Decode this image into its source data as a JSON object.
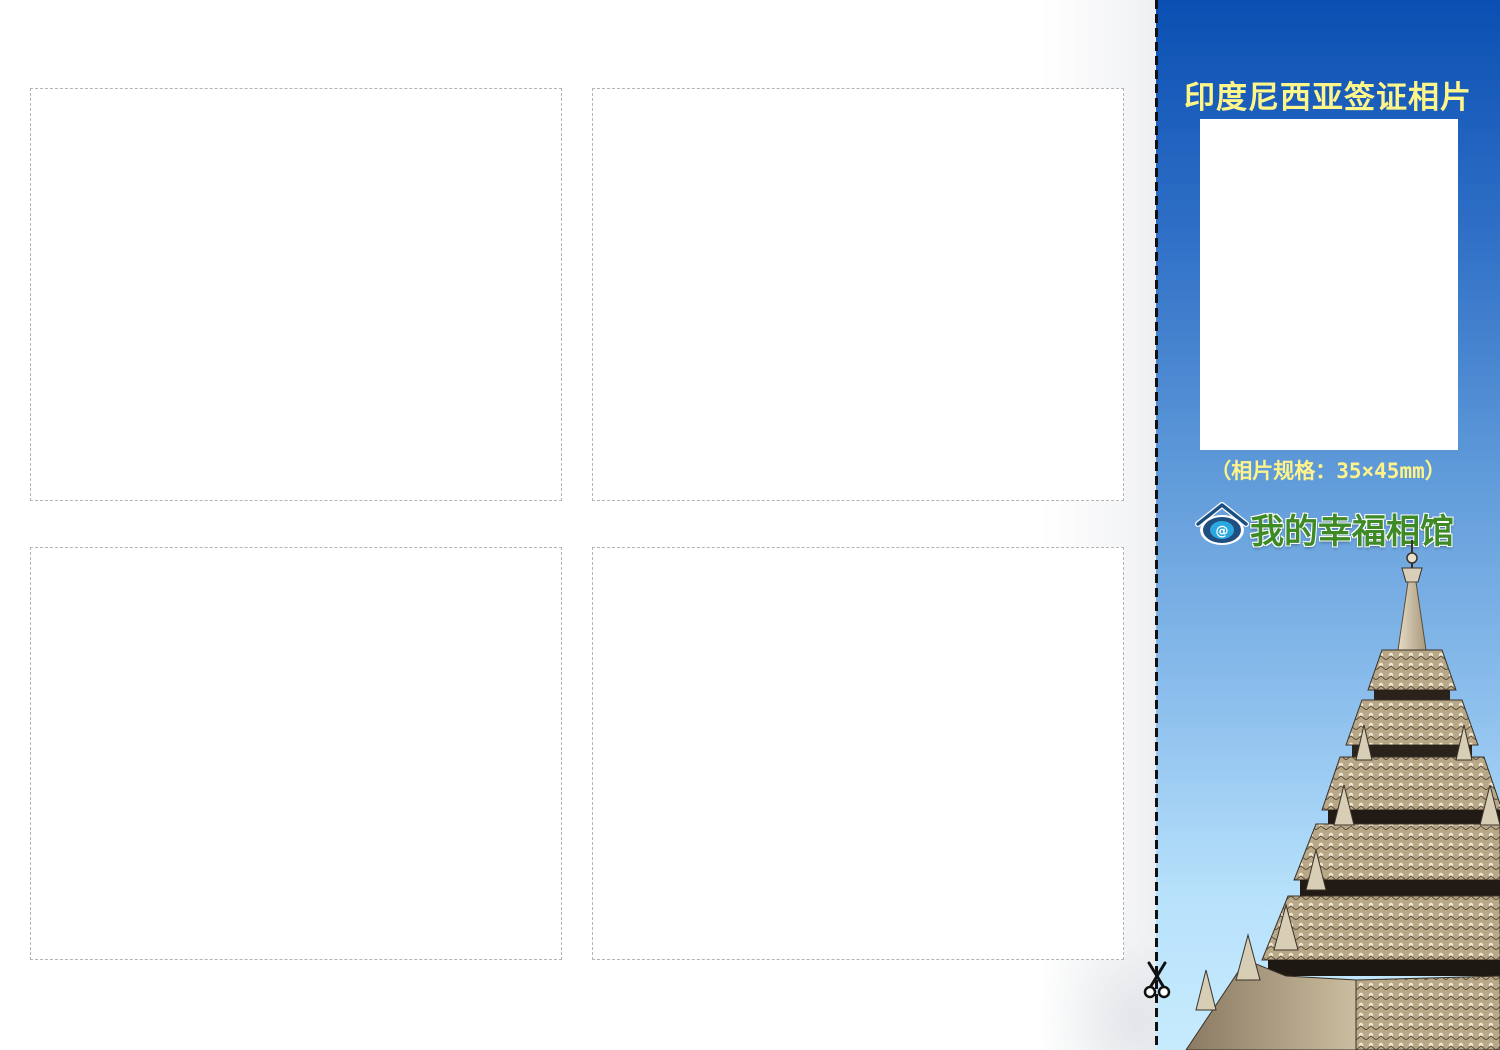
{
  "panel": {
    "title": "印度尼西亚签证相片",
    "photo_spec": "（相片规格：35×45mm）",
    "brand_name": "我的幸福相馆",
    "logo_glyph": "@"
  },
  "photo_slots": [
    {
      "id": "slot-1"
    },
    {
      "id": "slot-2"
    },
    {
      "id": "slot-3"
    },
    {
      "id": "slot-4"
    }
  ],
  "icons": {
    "scissors": "scissors-icon",
    "logo": "house-logo-icon",
    "decoration": "pagoda-image"
  },
  "colors": {
    "title": "#fff68a",
    "spec": "#fff48a",
    "brand": "#3d8a26",
    "panel_top": "#0a4fb2",
    "panel_bottom": "#c7ebfd",
    "slot_border": "#b4b4b4"
  }
}
